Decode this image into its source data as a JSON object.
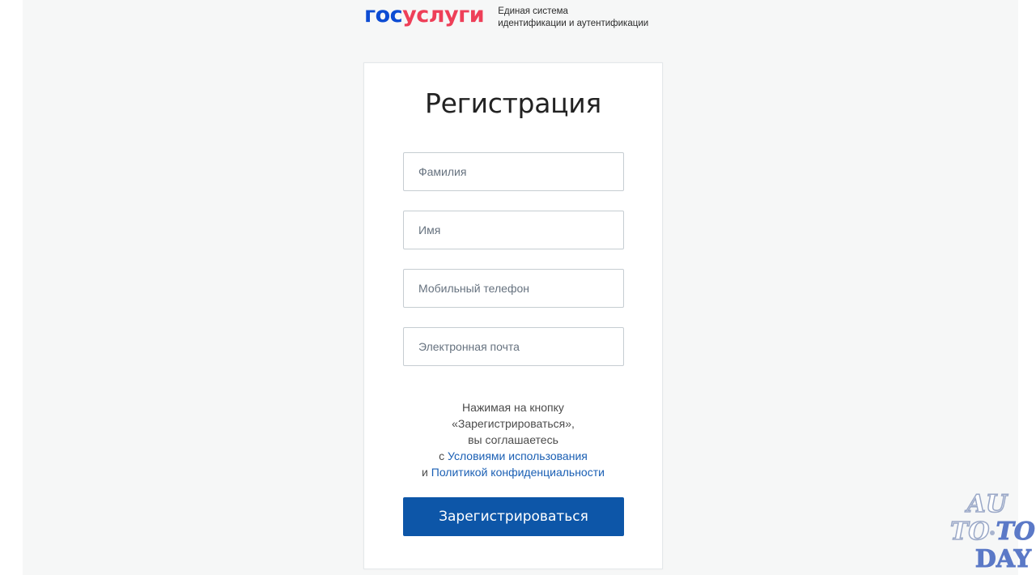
{
  "header": {
    "logo_part1": "гос",
    "logo_part2": "услуги",
    "tagline_line1": "Единая система",
    "tagline_line2": "идентификации и аутентификации"
  },
  "form": {
    "title": "Регистрация",
    "fields": [
      {
        "placeholder": "Фамилия",
        "value": ""
      },
      {
        "placeholder": "Имя",
        "value": ""
      },
      {
        "placeholder": "Мобильный телефон",
        "value": ""
      },
      {
        "placeholder": "Электронная почта",
        "value": ""
      }
    ],
    "agreement": {
      "line1": "Нажимая на кнопку",
      "line2": "«Зарегистрироваться»,",
      "line3": "вы соглашаетесь",
      "line4_prefix": "с",
      "terms_link": "Условиями использования",
      "line5_prefix": "и",
      "privacy_link": "Политикой конфиденциальности"
    },
    "submit_label": "Зарегистрироваться"
  },
  "watermark": {
    "line1": "AU",
    "line2_a": "TO",
    "line2_b": "TO",
    "line3": "DAY"
  },
  "colors": {
    "logo_blue": "#0d4cd3",
    "logo_red": "#ee3f58",
    "button_bg": "#0d56a8",
    "link": "#1a5fb4"
  }
}
